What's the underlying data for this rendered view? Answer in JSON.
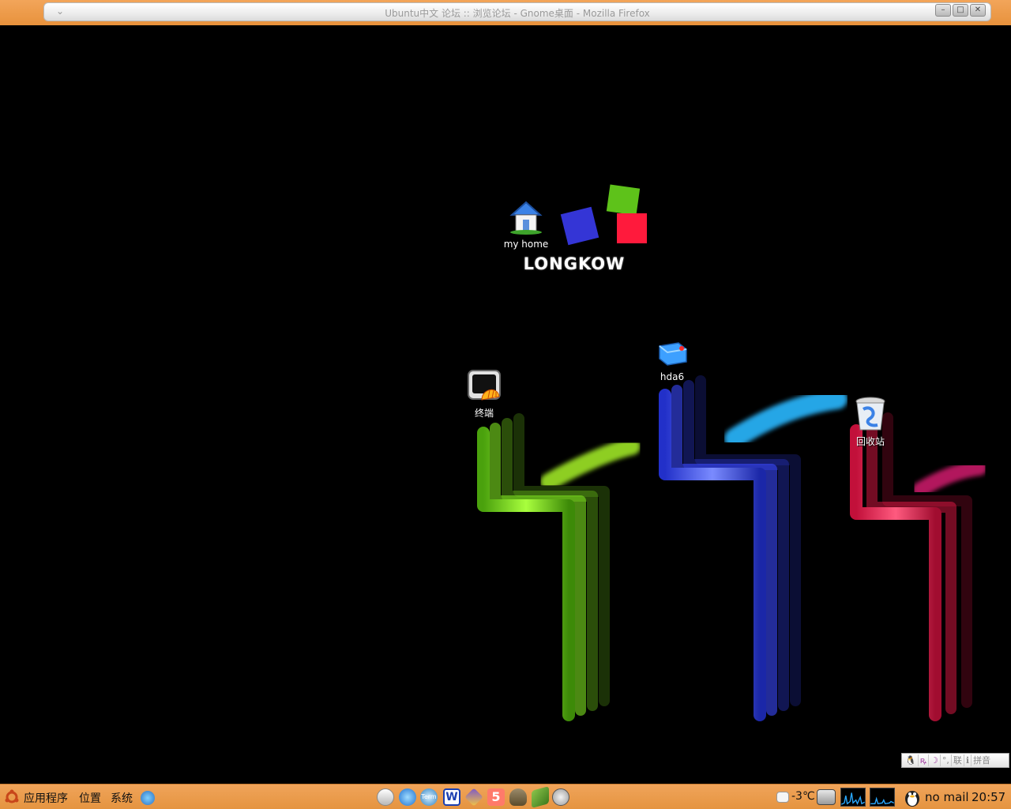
{
  "window": {
    "title": "Ubuntu中文 论坛 :: 浏览论坛 - Gnome桌面 - Mozilla Firefox"
  },
  "wallpaper": {
    "logo_text": "LONGKOW",
    "colors": {
      "green": "#7ee51f",
      "blue": "#3a49ff",
      "red": "#ff1b4e",
      "cyan": "#29b8ff",
      "magenta": "#d21c6e"
    }
  },
  "desktop_icons": [
    {
      "label": "my home",
      "icon": "home-folder-icon"
    },
    {
      "label": "hda6",
      "icon": "drive-icon"
    },
    {
      "label": "终端",
      "icon": "terminal-icon"
    },
    {
      "label": "回收站",
      "icon": "trash-icon"
    }
  ],
  "ime_bar": {
    "items": [
      "联",
      "拼音"
    ]
  },
  "panel": {
    "menus": [
      "应用程序",
      "位置",
      "系统"
    ],
    "launchers": [
      "files-icon",
      "browser-icon",
      "term-icon",
      "word-icon",
      "game-icon",
      "notes-icon",
      "gimp-icon",
      "book-icon",
      "media-icon"
    ],
    "temperature": "-3℃",
    "mail_status": "no mail",
    "clock": "20:57"
  }
}
